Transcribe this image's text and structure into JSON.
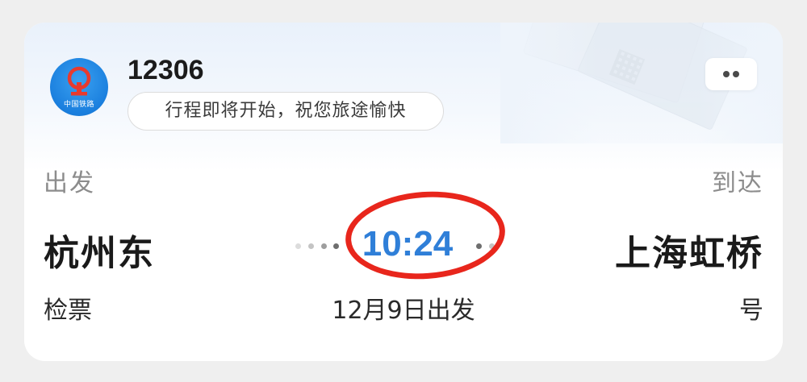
{
  "app": {
    "name": "12306",
    "logo_text": "中国铁路",
    "status_message": "行程即将开始，祝您旅途愉快"
  },
  "trip": {
    "departure_label": "出发",
    "arrival_label": "到达",
    "departure_station": "杭州东",
    "arrival_station": "上海虹桥",
    "departure_time": "10:24",
    "departure_date": "12月9日出发",
    "gate_partial": "检票",
    "seat_partial": "号"
  },
  "colors": {
    "time_blue": "#2f7fd8",
    "logo_blue": "#1a7fde",
    "annotation_red": "#e8261c"
  },
  "icons": {
    "logo": "china-railway-logo-icon",
    "more": "more-dots-icon"
  }
}
